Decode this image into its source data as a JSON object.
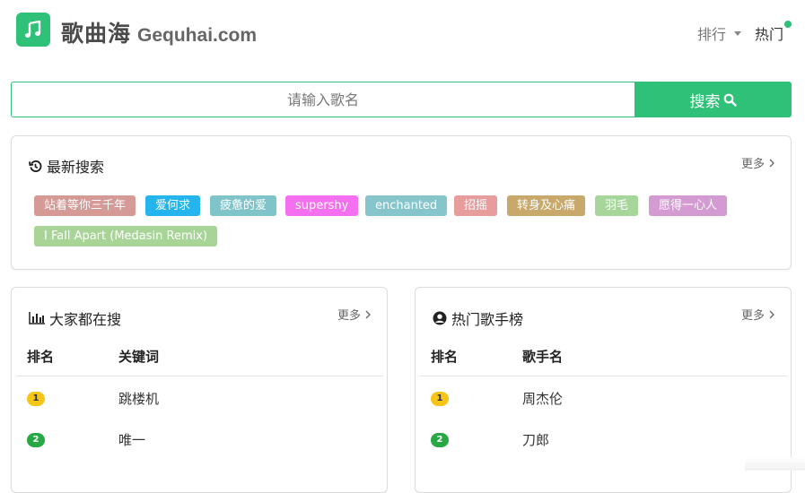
{
  "brand": {
    "name_cn": "歌曲海",
    "name_en": "Gequhai.com"
  },
  "nav": {
    "rank_label": "排行",
    "hot_label": "热门"
  },
  "search": {
    "placeholder": "请输入歌名",
    "button_label": "搜索"
  },
  "latest": {
    "title": "最新搜索",
    "more_label": "更多",
    "tags": [
      {
        "label": "站着等你三千年",
        "color": "#d69a96"
      },
      {
        "label": "爱何求",
        "color": "#24b5ee"
      },
      {
        "label": "疲惫的爱",
        "color": "#7ec4c9"
      },
      {
        "label": "supershy",
        "color": "#f570f0"
      },
      {
        "label": "enchanted",
        "color": "#86c5cc"
      },
      {
        "label": "招摇",
        "color": "#e69d9c"
      },
      {
        "label": "转身及心痛",
        "color": "#c8a96b"
      },
      {
        "label": "羽毛",
        "color": "#a7d69a"
      },
      {
        "label": "愿得一心人",
        "color": "#d39bd2"
      },
      {
        "label": "I Fall Apart (Medasin Remix)",
        "color": "#a8d497"
      }
    ]
  },
  "popular": {
    "title": "大家都在搜",
    "more_label": "更多",
    "col_rank": "排名",
    "col_keyword": "关键词",
    "rows": [
      {
        "rank": "1",
        "text": "跳楼机"
      },
      {
        "rank": "2",
        "text": "唯一"
      }
    ]
  },
  "singers": {
    "title": "热门歌手榜",
    "more_label": "更多",
    "col_rank": "排名",
    "col_name": "歌手名",
    "rows": [
      {
        "rank": "1",
        "text": "周杰伦"
      },
      {
        "rank": "2",
        "text": "刀郎"
      }
    ]
  },
  "colors": {
    "accent": "#2fc177",
    "badge_gold": "#f5c518",
    "badge_green": "#28a745"
  }
}
